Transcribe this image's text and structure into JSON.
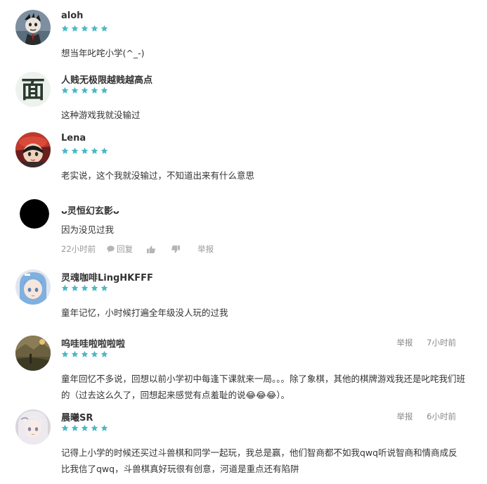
{
  "accent_color": "#4db8c4",
  "rating_max": 5,
  "comments": [
    {
      "user": "aloh",
      "avatar": "dark-character-avatar",
      "rating": 5,
      "text": "想当年叱咤小学(^_-)"
    },
    {
      "user": "人贱无极限越贱越高点",
      "avatar": "calligraphy-mian-avatar",
      "avatar_char": "面",
      "rating": 5,
      "text": "这种游戏我就没输过"
    },
    {
      "user": "Lena",
      "avatar": "anime-red-hat-avatar",
      "rating": 5,
      "text": "老实说，这个我就没输过，不知道出来有什么意思"
    },
    {
      "user": "ᴗ灵恒幻玄影ᴗ",
      "avatar": "black-circle-avatar",
      "text": "因为没见过我",
      "time": "22小时前",
      "reply_label": "回复",
      "like_icon": "thumbs-up-icon",
      "dislike_icon": "thumbs-down-icon",
      "report_label": "举报"
    },
    {
      "user": "灵魂咖啡LingHKFFF",
      "avatar": "anime-blue-hair-avatar",
      "rating": 5,
      "text": "童年记忆，小时候打遍全年级没人玩的过我"
    },
    {
      "user": "呜哇哇啦啦啦啦",
      "avatar": "landscape-avatar",
      "rating": 5,
      "report_label": "举报",
      "time": "7小时前",
      "text": "童年回忆不多说，回想以前小学初中每逢下课就来一局。。。除了象棋，其他的棋牌游戏我还是叱咤我们班的（过去这么久了，回想起来感觉有点羞耻的说😂😂😂）。"
    },
    {
      "user": "晨曦SR",
      "avatar": "anime-white-hair-avatar",
      "rating": 5,
      "report_label": "举报",
      "time": "6小时前",
      "text": "记得上小学的时候还买过斗兽棋和同学一起玩，我总是赢，他们智商都不如我qwq听说智商和情商成反比我信了qwq，斗兽棋真好玩很有创意，河道是重点还有陷阱"
    }
  ]
}
